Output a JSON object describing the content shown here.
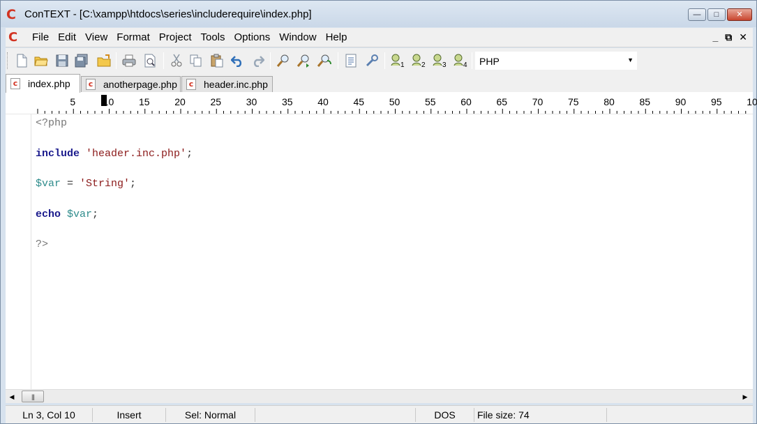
{
  "window": {
    "title": "ConTEXT - [C:\\xampp\\htdocs\\series\\includerequire\\index.php]",
    "logo": "C",
    "minimize_glyph": "—",
    "maximize_glyph": "□",
    "close_glyph": "✕"
  },
  "menubar": {
    "items": [
      "File",
      "Edit",
      "View",
      "Format",
      "Project",
      "Tools",
      "Options",
      "Window",
      "Help"
    ],
    "mdi_minimize": "_",
    "mdi_restore": "⧉",
    "mdi_close": "✕"
  },
  "toolbar": {
    "icons": [
      "new-file-icon",
      "open-file-icon",
      "save-icon",
      "save-all-icon",
      "open-folder-icon",
      "print-icon",
      "print-preview-icon",
      "cut-icon",
      "copy-icon",
      "paste-icon",
      "undo-icon",
      "redo-icon",
      "find-icon",
      "find-next-icon",
      "replace-icon",
      "document-props-icon",
      "tools-icon",
      "user-command-1-icon",
      "user-command-2-icon",
      "user-command-3-icon",
      "user-command-4-icon"
    ],
    "language": "PHP"
  },
  "tabs": [
    {
      "label": "index.php",
      "active": true
    },
    {
      "label": "anotherpage.php",
      "active": false
    },
    {
      "label": "header.inc.php",
      "active": false
    }
  ],
  "ruler": {
    "labels": [
      "5",
      "10",
      "15",
      "20",
      "25",
      "30",
      "35",
      "40",
      "45",
      "50",
      "55",
      "60",
      "65",
      "70",
      "75",
      "80",
      "85",
      "90",
      "95",
      "10"
    ]
  },
  "editor": {
    "lines": [
      [
        {
          "t": "<?php",
          "c": "php-tag"
        }
      ],
      [],
      [
        {
          "t": "include",
          "c": "kw"
        },
        {
          "t": " ",
          "c": "op"
        },
        {
          "t": "'header.inc.php'",
          "c": "str"
        },
        {
          "t": ";",
          "c": "op"
        }
      ],
      [],
      [
        {
          "t": "$var",
          "c": "var"
        },
        {
          "t": " = ",
          "c": "op"
        },
        {
          "t": "'String'",
          "c": "str"
        },
        {
          "t": ";",
          "c": "op"
        }
      ],
      [],
      [
        {
          "t": "echo",
          "c": "kw"
        },
        {
          "t": " ",
          "c": "op"
        },
        {
          "t": "$var",
          "c": "var"
        },
        {
          "t": ";",
          "c": "op"
        }
      ],
      [],
      [
        {
          "t": "?>",
          "c": "php-tag"
        }
      ]
    ]
  },
  "scrollbar": {
    "left_arrow": "◀",
    "right_arrow": "▶",
    "grip": "|||"
  },
  "statusbar": {
    "position": "Ln 3, Col 10",
    "mode": "Insert",
    "selection": "Sel: Normal",
    "line_ending": "DOS",
    "file_size": "File size: 74"
  },
  "colors": {
    "keyword": "#1a1a8c",
    "string": "#8b1a1a",
    "variable": "#2f8c8c",
    "php_tag": "#777777",
    "logo": "#d23322"
  }
}
